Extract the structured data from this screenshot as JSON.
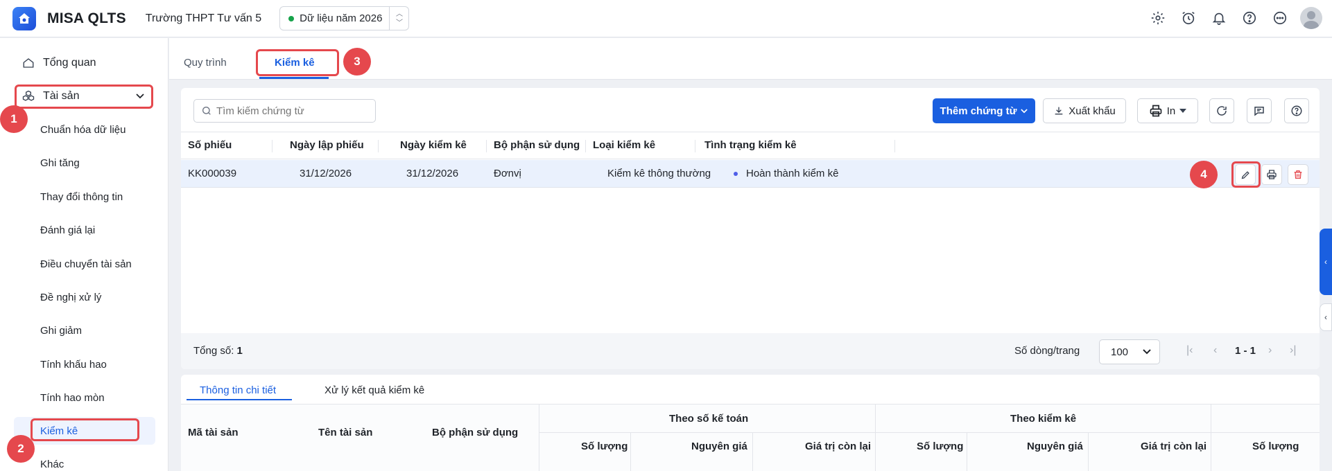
{
  "app": {
    "name": "MISA QLTS",
    "school": "Trường THPT Tư vấn 5",
    "data_year": "Dữ liệu năm 2026"
  },
  "header_icons": [
    "gear-icon",
    "alarm-icon",
    "bell-icon",
    "help-icon",
    "more-icon",
    "avatar"
  ],
  "sidebar": {
    "overview": "Tổng quan",
    "assets": "Tài sản",
    "items": [
      "Chuẩn hóa dữ liệu",
      "Ghi tăng",
      "Thay đổi thông tin",
      "Đánh giá lại",
      "Điều chuyển tài sản",
      "Đề nghị xử lý",
      "Ghi giảm",
      "Tính khấu hao",
      "Tính hao mòn",
      "Kiểm kê",
      "Khác"
    ],
    "active": "Kiểm kê"
  },
  "tabs": {
    "process": "Quy trình",
    "inventory": "Kiểm kê",
    "active": "Kiểm kê"
  },
  "toolbar": {
    "search_placeholder": "Tìm kiếm chứng từ",
    "add_label": "Thêm chứng từ",
    "export_label": "Xuất khẩu",
    "print_label": "In"
  },
  "table": {
    "columns": [
      "Số phiếu",
      "Ngày lập phiếu",
      "Ngày kiểm kê",
      "Bộ phận sử dụng",
      "Loại kiểm kê",
      "Tình trạng kiểm kê"
    ],
    "rows": [
      {
        "so_phieu": "KK000039",
        "ngay_lap": "31/12/2026",
        "ngay_kiem_ke": "31/12/2026",
        "bo_phan": "Đơnvị",
        "loai": "Kiểm kê thông thường",
        "tinh_trang": "Hoàn thành kiểm kê"
      }
    ]
  },
  "footer": {
    "total_label": "Tổng số:",
    "total_value": "1",
    "rows_per_page_label": "Số dòng/trang",
    "rows_per_page": "100",
    "page_range": "1 - 1"
  },
  "detail": {
    "tabs": [
      "Thông tin chi tiết",
      "Xử lý kết quả kiểm kê"
    ],
    "active_tab": "Thông tin chi tiết",
    "columns": {
      "ma_tai_san": "Mã tài sản",
      "ten_tai_san": "Tên tài sản",
      "bo_phan": "Bộ phận sử dụng",
      "group_so_ke_toan": "Theo số kế toán",
      "group_kiem_ke": "Theo kiểm kê",
      "so_luong": "Số lượng",
      "nguyen_gia": "Nguyên giá",
      "gia_tri_con_lai": "Giá trị còn lại"
    }
  },
  "annotations": [
    "1",
    "2",
    "3",
    "4"
  ],
  "colors": {
    "primary": "#1a5fe0",
    "highlight": "#e5484d",
    "status_dot": "#4f5ee8",
    "year_dot": "#16a34a"
  }
}
